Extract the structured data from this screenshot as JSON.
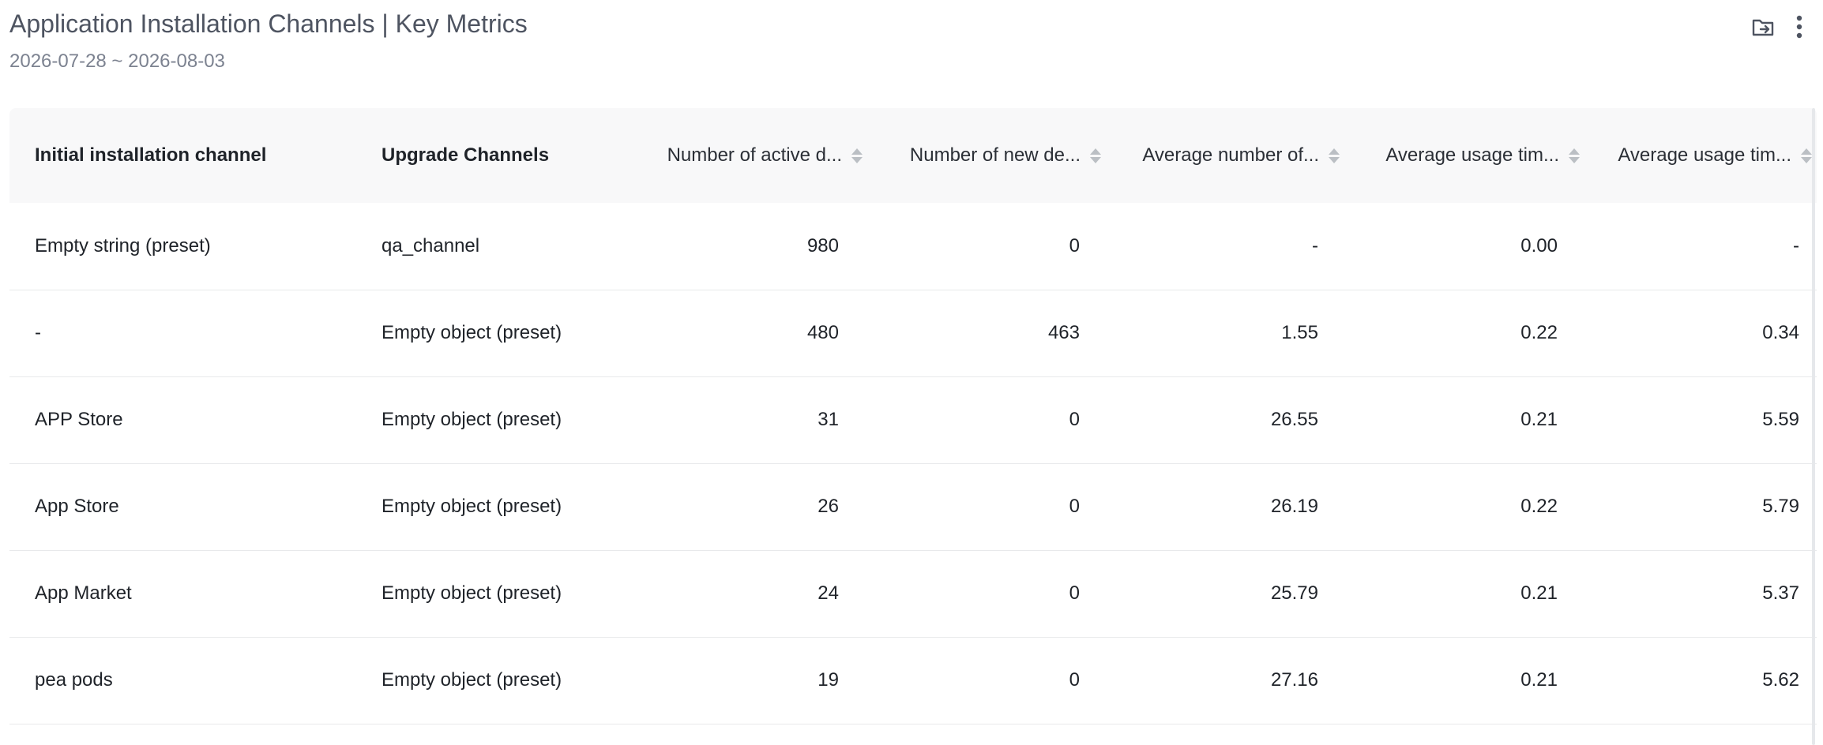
{
  "header": {
    "title": "Application Installation Channels | Key Metrics",
    "date_range": "2026-07-28 ~ 2026-08-03",
    "icons": [
      "export-icon",
      "more-icon"
    ]
  },
  "table": {
    "columns": [
      "Initial installation channel",
      "Upgrade Channels",
      "Number of active d...",
      "Number of new de...",
      "Average number of...",
      "Average usage tim...",
      "Average usage tim..."
    ],
    "rows": [
      [
        "Empty string (preset)",
        "qa_channel",
        "980",
        "0",
        "-",
        "0.00",
        "-"
      ],
      [
        "-",
        "Empty object (preset)",
        "480",
        "463",
        "1.55",
        "0.22",
        "0.34"
      ],
      [
        "APP Store",
        "Empty object (preset)",
        "31",
        "0",
        "26.55",
        "0.21",
        "5.59"
      ],
      [
        "App Store",
        "Empty object (preset)",
        "26",
        "0",
        "26.19",
        "0.22",
        "5.79"
      ],
      [
        "App Market",
        "Empty object (preset)",
        "24",
        "0",
        "25.79",
        "0.21",
        "5.37"
      ],
      [
        "pea pods",
        "Empty object (preset)",
        "19",
        "0",
        "27.16",
        "0.21",
        "5.62"
      ]
    ]
  }
}
